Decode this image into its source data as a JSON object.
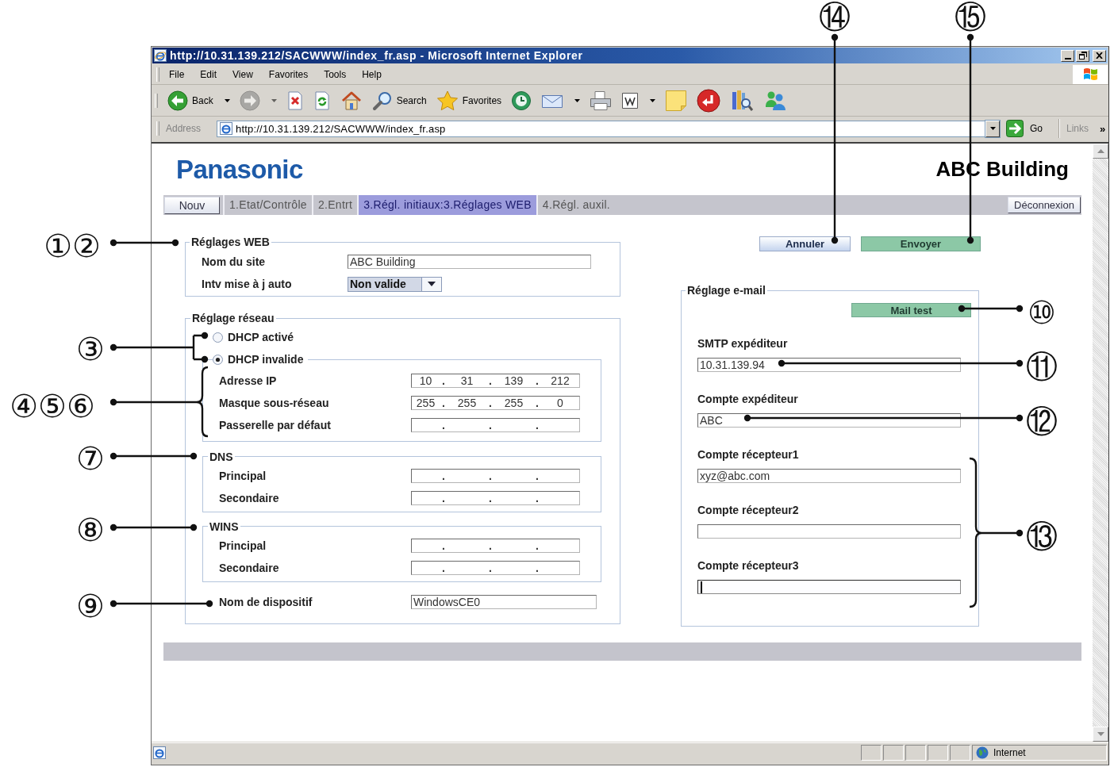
{
  "window": {
    "title": "http://10.31.139.212/SACWWW/index_fr.asp - Microsoft Internet Explorer"
  },
  "menu_bar": [
    "File",
    "Edit",
    "View",
    "Favorites",
    "Tools",
    "Help"
  ],
  "toolbar": [
    {
      "kind": "back",
      "label": "Back",
      "dropdown": true,
      "disabled": false
    },
    {
      "kind": "forward",
      "dropdown": true,
      "disabled": true
    },
    {
      "kind": "stop",
      "dropdown": false,
      "disabled": false
    },
    {
      "kind": "refresh",
      "dropdown": false,
      "disabled": false
    },
    {
      "kind": "home",
      "dropdown": false,
      "disabled": false
    },
    {
      "kind": "search",
      "label": "Search",
      "dropdown": false,
      "disabled": false
    },
    {
      "kind": "favorites",
      "label": "Favorites",
      "dropdown": false,
      "disabled": false
    },
    {
      "kind": "history",
      "dropdown": false,
      "disabled": false
    },
    {
      "kind": "mail",
      "dropdown": true,
      "disabled": false
    },
    {
      "kind": "print",
      "dropdown": false,
      "disabled": false
    },
    {
      "kind": "word",
      "dropdown": true,
      "disabled": false
    },
    {
      "kind": "note",
      "dropdown": false,
      "disabled": false
    },
    {
      "kind": "return",
      "dropdown": false,
      "disabled": false
    },
    {
      "kind": "research",
      "dropdown": false,
      "disabled": false
    },
    {
      "kind": "messenger",
      "dropdown": false,
      "disabled": false
    }
  ],
  "address_bar": {
    "label": "Address",
    "url": "http://10.31.139.212/SACWWW/index_fr.asp",
    "go": "Go",
    "links": "Links",
    "more": "»"
  },
  "page": {
    "logo": "Panasonic",
    "site_title": "ABC Building",
    "nav": {
      "new_button": "Nouv",
      "tabs": [
        {
          "label": "1.Etat/Contrôle",
          "selected": false
        },
        {
          "label": "2.Entrt",
          "selected": false
        },
        {
          "label": "3.Régl. initiaux:3.Réglages WEB",
          "selected": true
        },
        {
          "label": "4.Régl. auxil.",
          "selected": false
        }
      ],
      "logout_button": "Déconnexion"
    },
    "actions": {
      "cancel": "Annuler",
      "send": "Envoyer"
    },
    "web_settings": {
      "title": "Réglages WEB",
      "site_name": {
        "label": "Nom du site",
        "value": "ABC Building"
      },
      "auto_update": {
        "label": "Intv mise à j auto",
        "value": "Non valide"
      }
    },
    "network": {
      "title": "Réglage réseau",
      "dhcp_options": [
        {
          "label": "DHCP activé",
          "selected": false
        },
        {
          "label": "DHCP invalide",
          "selected": true
        }
      ],
      "static_fields": [
        {
          "label": "Adresse IP",
          "octets": [
            "10",
            "31",
            "139",
            "212"
          ],
          "dots": [
            ".",
            ".",
            "."
          ]
        },
        {
          "label": "Masque sous-réseau",
          "octets": [
            "255",
            "255",
            "255",
            "0"
          ],
          "dots": [
            ".",
            ".",
            "."
          ]
        },
        {
          "label": "Passerelle par défaut",
          "dots": [
            ".",
            ".",
            "."
          ]
        }
      ],
      "dns": {
        "title": "DNS",
        "fields": [
          {
            "label": "Principal",
            "dots": [
              ".",
              ".",
              "."
            ]
          },
          {
            "label": "Secondaire",
            "dots": [
              ".",
              ".",
              "."
            ]
          }
        ]
      },
      "wins": {
        "title": "WINS",
        "fields": [
          {
            "label": "Principal",
            "dots": [
              ".",
              ".",
              "."
            ]
          },
          {
            "label": "Secondaire",
            "dots": [
              ".",
              ".",
              "."
            ]
          }
        ]
      },
      "device_name": {
        "label": "Nom de dispositif",
        "value": "WindowsCE0"
      }
    },
    "email": {
      "title": "Réglage e-mail",
      "test_button": "Mail test",
      "fields": [
        {
          "label": "SMTP expéditeur",
          "value": "10.31.139.94",
          "focused": false
        },
        {
          "label": "Compte expéditeur",
          "value": "ABC",
          "focused": false
        },
        {
          "label": "Compte récepteur1",
          "value": "xyz@abc.com",
          "focused": false
        },
        {
          "label": "Compte récepteur2",
          "focused": false
        },
        {
          "label": "Compte récepteur3",
          "focused": true
        }
      ]
    }
  },
  "status_bar": {
    "zone": "Internet"
  },
  "callouts": [
    {
      "label": "⑭"
    },
    {
      "label": "⑮"
    },
    {
      "label": "①②"
    },
    {
      "label": "③"
    },
    {
      "label": "④⑤⑥"
    },
    {
      "label": "⑦"
    },
    {
      "label": "⑧"
    },
    {
      "label": "⑨"
    },
    {
      "label": "⑩"
    },
    {
      "label": "⑪"
    },
    {
      "label": "⑫"
    },
    {
      "label": "⑬"
    }
  ]
}
